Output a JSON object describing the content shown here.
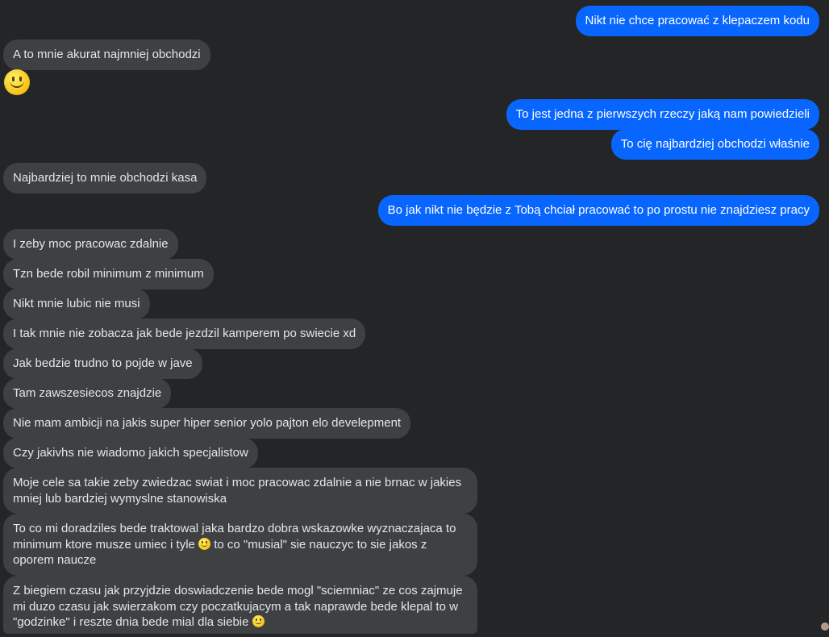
{
  "messages": [
    {
      "id": "m1",
      "side": "out",
      "text": "Nikt nie chce pracować z klepaczem kodu"
    },
    {
      "id": "m2",
      "side": "in",
      "text": "A to mnie akurat najmniej obchodzi"
    },
    {
      "id": "m3",
      "side": "in",
      "emoji": "smiling-face"
    },
    {
      "id": "m4",
      "side": "out",
      "text": "To jest jedna z pierwszych rzeczy jaką nam powiedzieli"
    },
    {
      "id": "m5",
      "side": "out",
      "text": "To cię najbardziej obchodzi właśnie"
    },
    {
      "id": "m6",
      "side": "in",
      "text": "Najbardziej to mnie obchodzi kasa"
    },
    {
      "id": "m7",
      "side": "out",
      "text": "Bo jak nikt nie będzie z Tobą chciał pracować to po prostu nie znajdziesz pracy"
    },
    {
      "id": "m8",
      "side": "in",
      "text": "I zeby moc pracowac zdalnie"
    },
    {
      "id": "m9",
      "side": "in",
      "text": "Tzn bede robil minimum z minimum"
    },
    {
      "id": "m10",
      "side": "in",
      "text": "Nikt mnie lubic nie musi"
    },
    {
      "id": "m11",
      "side": "in",
      "text": "I tak mnie nie zobacza jak bede jezdzil kamperem po swiecie xd"
    },
    {
      "id": "m12",
      "side": "in",
      "text": "Jak bedzie trudno to pojde w jave"
    },
    {
      "id": "m13",
      "side": "in",
      "text": "Tam zawszesiecos znajdzie"
    },
    {
      "id": "m14",
      "side": "in",
      "text": "Nie mam ambicji na jakis super hiper senior yolo pajton elo develepment"
    },
    {
      "id": "m15",
      "side": "in",
      "text": "Czy jakivhs nie wiadomo jakich specjalistow"
    },
    {
      "id": "m16",
      "side": "in",
      "text": "Moje cele sa takie zeby zwiedzac swiat i moc pracowac zdalnie a nie brnac w jakies mniej lub bardziej wymyslne stanowiska"
    },
    {
      "id": "m17",
      "side": "in",
      "text_a": "To co mi doradziles bede traktowal jaka bardzo dobra wskazowke wyznaczajaca to minimum ktore musze umiec i tyle",
      "text_b": "to co \"musial\" sie nauczyc to sie jakos z oporem naucze"
    },
    {
      "id": "m18",
      "side": "in",
      "text_a": "Z biegiem czasu jak przyjdzie doswiadczenie bede mogl \"sciemniac\" ze cos zajmuje mi duzo czasu jak swierzakom czy poczatkujacym a tak naprawde bede klepal to w \"godzinke\" i reszte dnia bede mial dla siebie"
    }
  ],
  "colors": {
    "background": "#242526",
    "incoming_bubble": "#3e4042",
    "outgoing_bubble": "#0866ff",
    "text": "#e4e6eb"
  }
}
